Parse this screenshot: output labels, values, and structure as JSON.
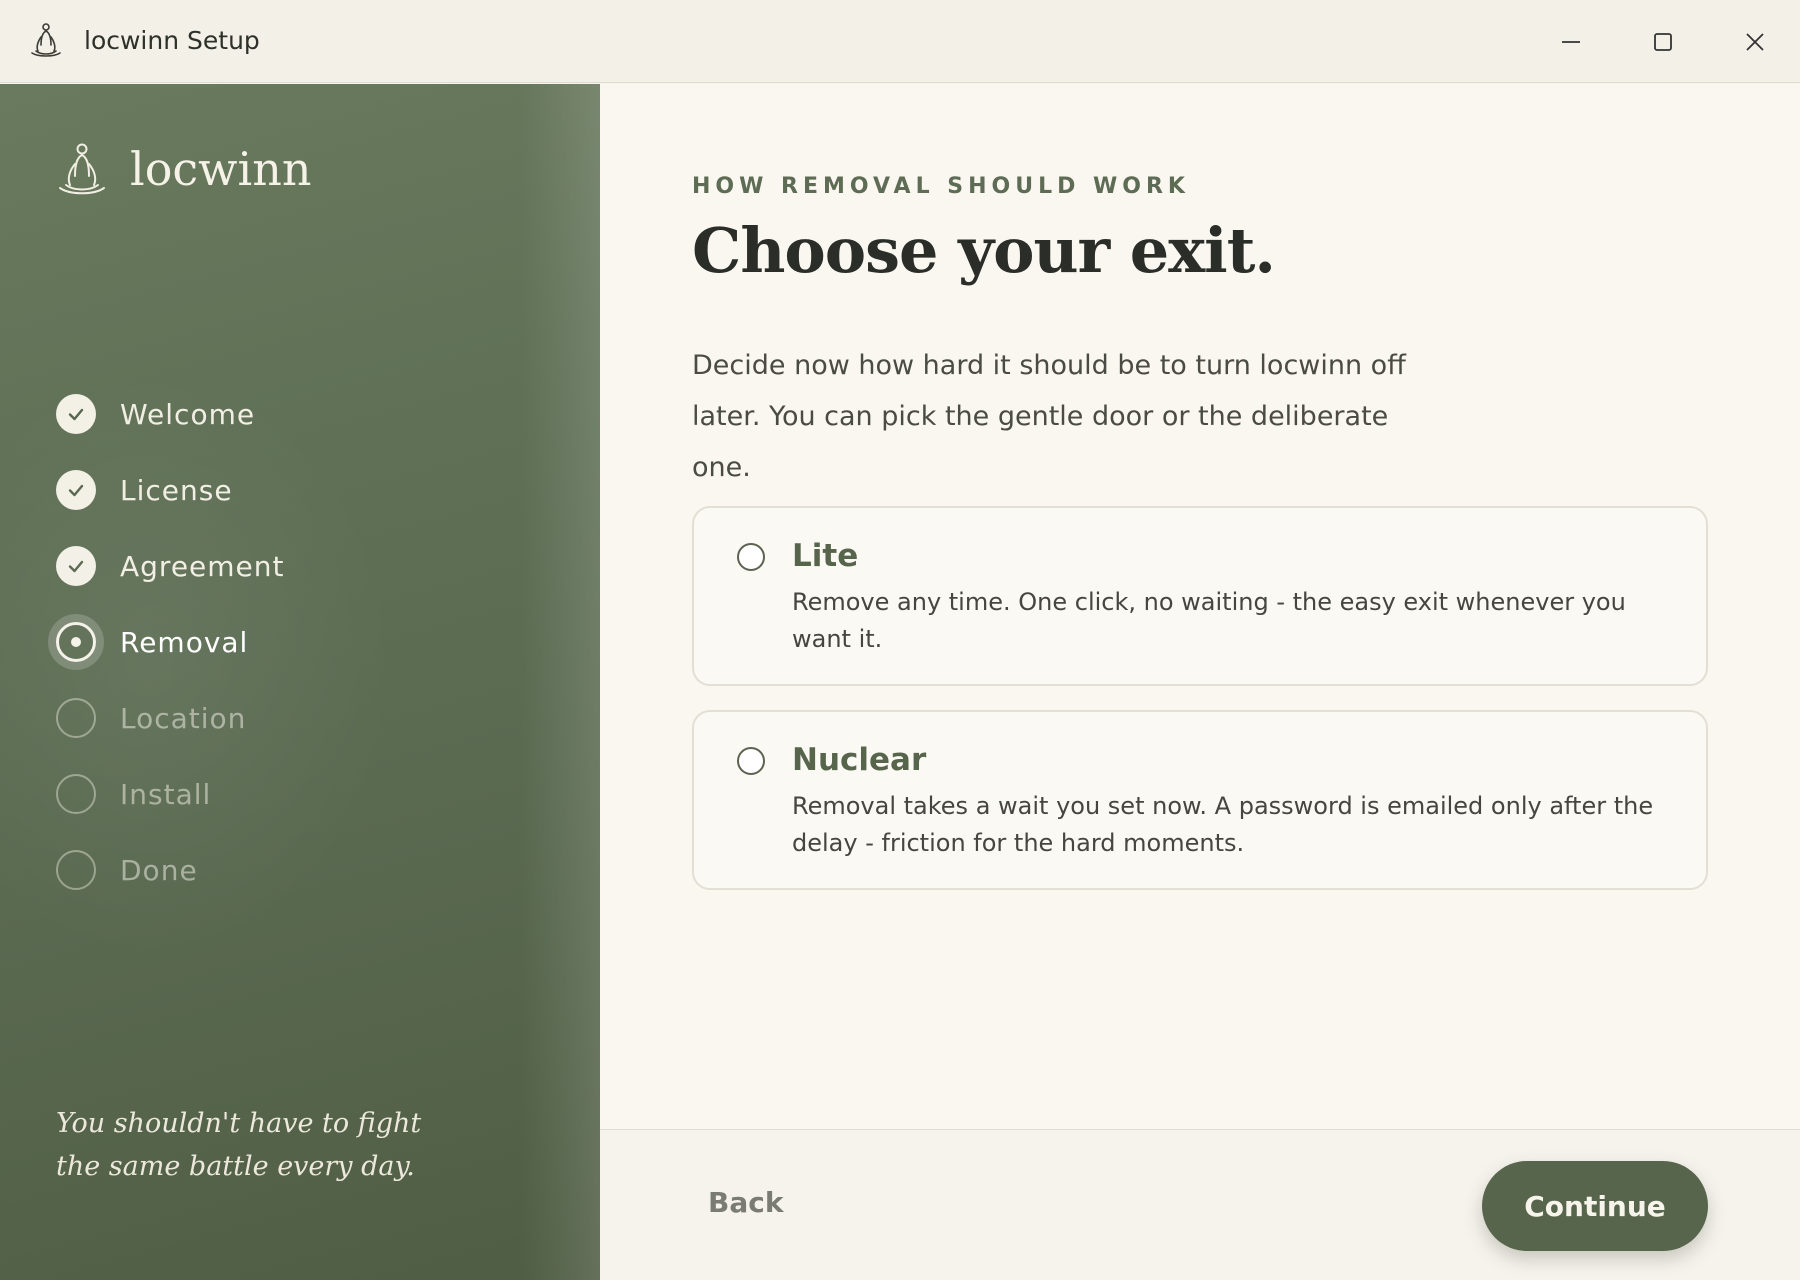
{
  "window": {
    "title": "locwinn Setup",
    "icon": "meditation-figure-icon",
    "controls": [
      "minimize-icon",
      "maximize-icon",
      "close-icon"
    ]
  },
  "sidebar": {
    "brand": "locwinn",
    "steps": [
      {
        "label": "Welcome",
        "state": "done"
      },
      {
        "label": "License",
        "state": "done"
      },
      {
        "label": "Agreement",
        "state": "done"
      },
      {
        "label": "Removal",
        "state": "current"
      },
      {
        "label": "Location",
        "state": "todo"
      },
      {
        "label": "Install",
        "state": "todo"
      },
      {
        "label": "Done",
        "state": "todo"
      }
    ],
    "quote_line1": "You shouldn't have to fight",
    "quote_line2": "the same battle every day."
  },
  "main": {
    "eyebrow": "HOW REMOVAL SHOULD WORK",
    "headline": "Choose your exit.",
    "intro": "Decide now how hard it should be to turn locwinn off later. You can pick the gentle door or the deliberate one.",
    "options": [
      {
        "title": "Lite",
        "description": "Remove any time. One click, no waiting - the easy exit whenever you want it.",
        "selected": false
      },
      {
        "title": "Nuclear",
        "description": "Removal takes a wait you set now. A password is emailed only after the delay - friction for the hard moments.",
        "selected": false
      }
    ]
  },
  "footer": {
    "back_label": "Back",
    "continue_label": "Continue"
  },
  "colors": {
    "accent": "#56654b",
    "sidebar": "#5f6f55",
    "background": "#faf7f0"
  }
}
